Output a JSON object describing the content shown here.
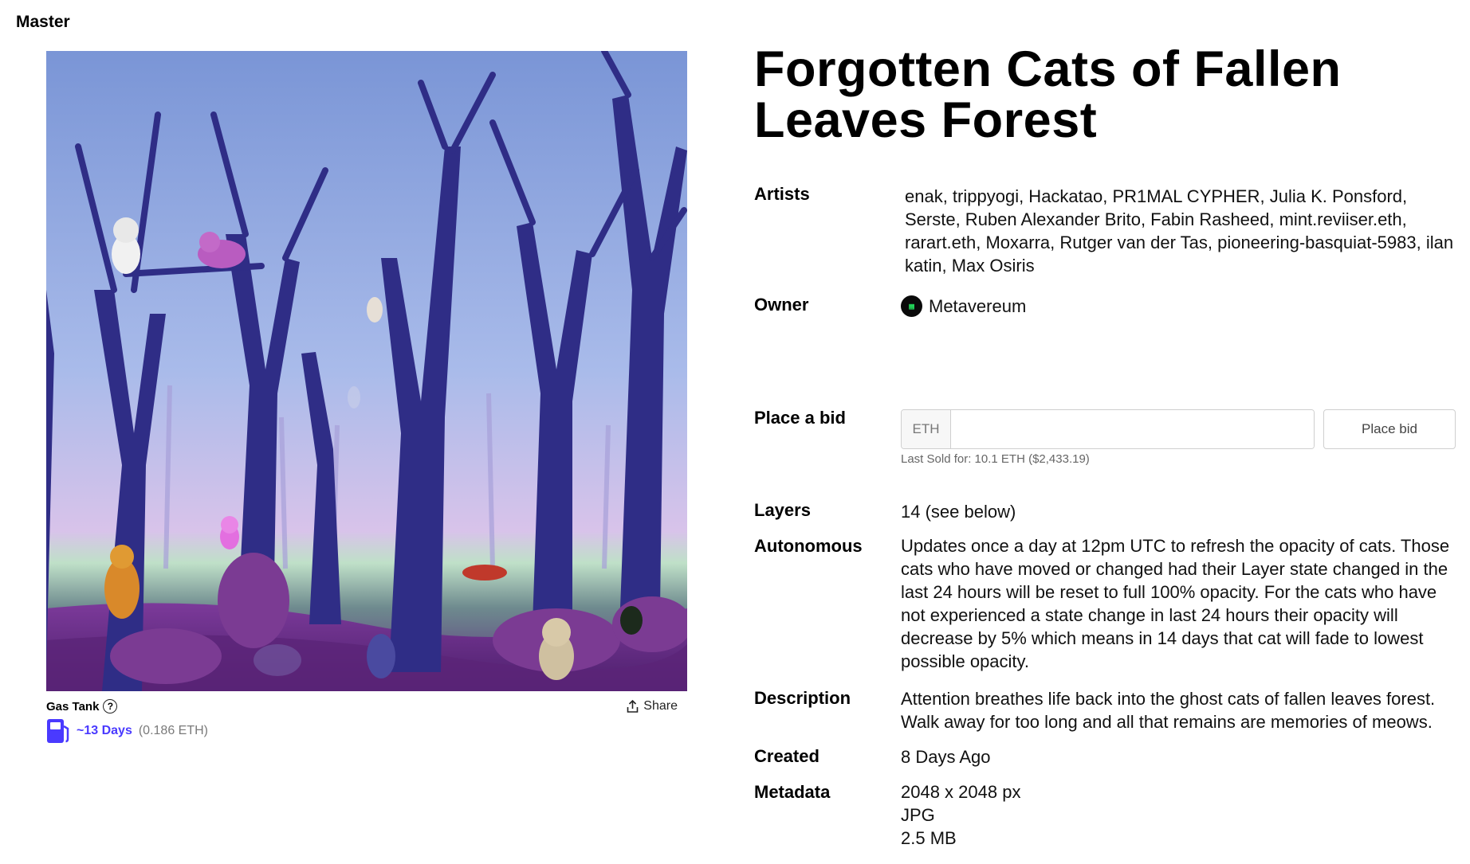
{
  "header": {
    "label": "Master"
  },
  "artwork": {
    "alt": "Forgotten Cats of Fallen Leaves Forest artwork"
  },
  "gas_tank": {
    "title": "Gas Tank",
    "help": "?",
    "days": "~13 Days",
    "eth": "(0.186 ETH)",
    "share_label": "Share"
  },
  "detail": {
    "title": "Forgotten Cats of Fallen Leaves Forest",
    "artists_label": "Artists",
    "artists_value": "enak, trippyogi, Hackatao, PR1MAL CYPHER, Julia K. Ponsford, Serste, Ruben Alexander Brito, Fabin Rasheed, mint.reviiser.eth, rarart.eth, Moxarra, Rutger van der Tas, pioneering-basquiat-5983, ilan katin, Max Osiris",
    "owner_label": "Owner",
    "owner_name": "Metavereum",
    "bid_label": "Place a bid",
    "bid_prefix": "ETH",
    "bid_value": "",
    "bid_button": "Place bid",
    "last_sold": "Last Sold for: 10.1 ETH ($2,433.19)",
    "layers_label": "Layers",
    "layers_value": "14 (see below)",
    "autonomous_label": "Autonomous",
    "autonomous_value": "Updates once a day at 12pm UTC to refresh the opacity of cats. Those cats who have moved or changed had their Layer state changed in the last 24 hours will be reset to full 100% opacity. For the cats who have not experienced a state change in last 24 hours their opacity will decrease by 5% which means in 14 days that cat will fade to lowest possible opacity.",
    "description_label": "Description",
    "description_value": "Attention breathes life back into the ghost cats of fallen leaves forest. Walk away for too long and all that remains are memories of meows.",
    "created_label": "Created",
    "created_value": "8 Days Ago",
    "metadata_label": "Metadata",
    "metadata_lines": [
      "2048 x 2048 px",
      "JPG",
      "2.5 MB"
    ]
  },
  "colors": {
    "accent": "#4a3aff",
    "sky_top": "#7a95d6",
    "sky_bottom": "#c9b8e6",
    "trunk": "#2c2a7a",
    "ground": "#6a2f8a"
  },
  "icons": [
    "help-icon",
    "share-icon",
    "gas-pump-icon",
    "owner-avatar"
  ]
}
